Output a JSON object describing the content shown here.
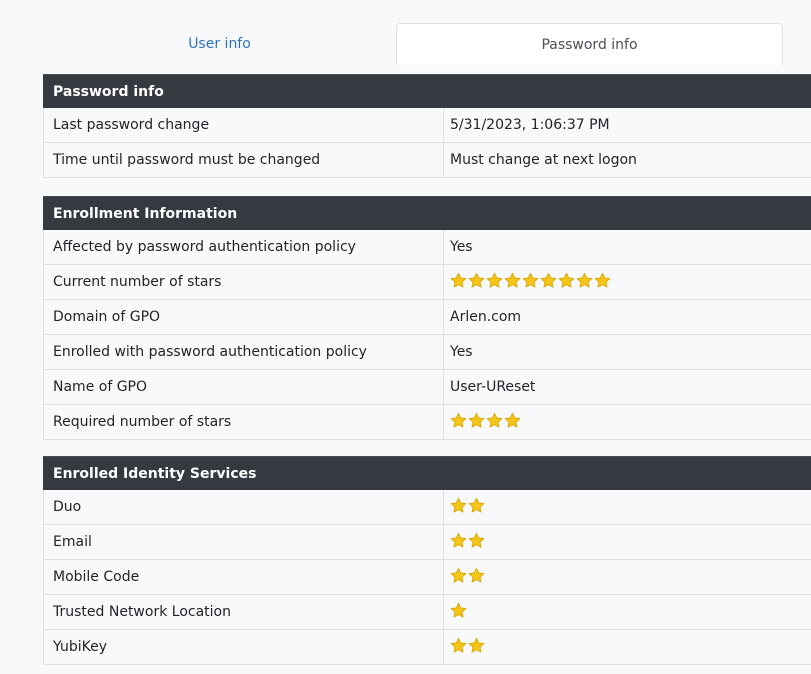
{
  "tabs": {
    "user_info": "User info",
    "password_info": "Password info"
  },
  "password_section": {
    "title": "Password info",
    "rows": [
      {
        "label": "Last password change",
        "value": "5/31/2023, 1:06:37 PM"
      },
      {
        "label": "Time until password must be changed",
        "value": "Must change at next logon"
      }
    ]
  },
  "enrollment_section": {
    "title": "Enrollment Information",
    "rows": [
      {
        "label": "Affected by password authentication policy",
        "value": "Yes"
      },
      {
        "label": "Current number of stars",
        "stars": 9
      },
      {
        "label": "Domain of GPO",
        "value": "Arlen.com"
      },
      {
        "label": "Enrolled with password authentication policy",
        "value": "Yes"
      },
      {
        "label": "Name of GPO",
        "value": "User-UReset"
      },
      {
        "label": "Required number of stars",
        "stars": 4
      }
    ]
  },
  "identity_section": {
    "title": "Enrolled Identity Services",
    "rows": [
      {
        "label": "Duo",
        "stars": 2
      },
      {
        "label": "Email",
        "stars": 2
      },
      {
        "label": "Mobile Code",
        "stars": 2
      },
      {
        "label": "Trusted Network Location",
        "stars": 1
      },
      {
        "label": "YubiKey",
        "stars": 2
      }
    ]
  },
  "colors": {
    "header_bg": "#343a40",
    "star_fill": "#f5c518",
    "star_stroke": "#d9a400",
    "tab_link": "#2f75b5"
  },
  "icons": {
    "star": "star-icon"
  }
}
